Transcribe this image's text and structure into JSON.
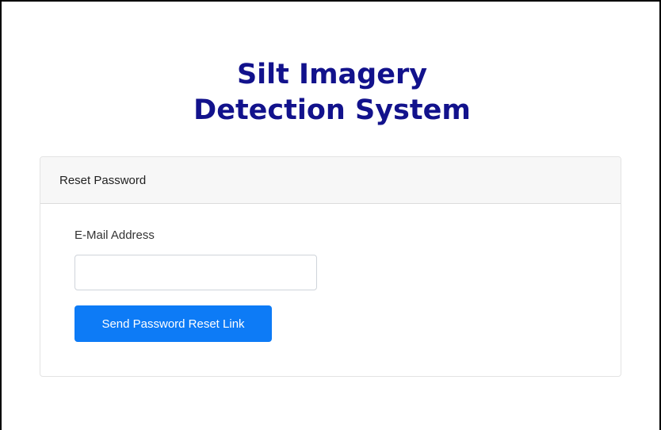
{
  "brand": {
    "line1": "Silt Imagery",
    "line2": "Detection System",
    "color": "#12128c"
  },
  "card": {
    "header": "Reset Password",
    "email_label": "E-Mail Address",
    "email_value": "",
    "email_placeholder": "",
    "submit_label": "Send Password Reset Link",
    "submit_color": "#0d7bf6"
  }
}
